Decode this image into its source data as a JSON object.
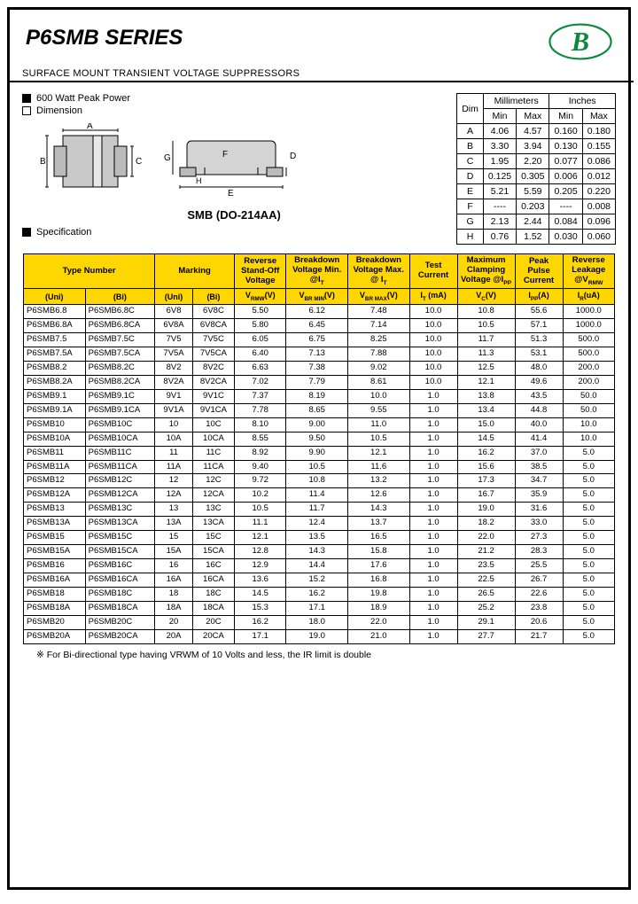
{
  "title": "P6SMB SERIES",
  "subtitle": "SURFACE MOUNT TRANSIENT VOLTAGE SUPPRESSORS",
  "bullets": {
    "peak_power": "600 Watt Peak Power",
    "dimension": "Dimension",
    "specification": "Specification"
  },
  "package_label": "SMB (DO-214AA)",
  "dim_headers": {
    "dim": "Dim",
    "mm": "Millimeters",
    "in": "Inches",
    "min": "Min",
    "max": "Max"
  },
  "dim_rows": [
    {
      "d": "A",
      "mm_min": "4.06",
      "mm_max": "4.57",
      "in_min": "0.160",
      "in_max": "0.180"
    },
    {
      "d": "B",
      "mm_min": "3.30",
      "mm_max": "3.94",
      "in_min": "0.130",
      "in_max": "0.155"
    },
    {
      "d": "C",
      "mm_min": "1.95",
      "mm_max": "2.20",
      "in_min": "0.077",
      "in_max": "0.086"
    },
    {
      "d": "D",
      "mm_min": "0.125",
      "mm_max": "0.305",
      "in_min": "0.006",
      "in_max": "0.012"
    },
    {
      "d": "E",
      "mm_min": "5.21",
      "mm_max": "5.59",
      "in_min": "0.205",
      "in_max": "0.220"
    },
    {
      "d": "F",
      "mm_min": "----",
      "mm_max": "0.203",
      "in_min": "----",
      "in_max": "0.008"
    },
    {
      "d": "G",
      "mm_min": "2.13",
      "mm_max": "2.44",
      "in_min": "0.084",
      "in_max": "0.096"
    },
    {
      "d": "H",
      "mm_min": "0.76",
      "mm_max": "1.52",
      "in_min": "0.030",
      "in_max": "0.060"
    }
  ],
  "spec_headers": {
    "type_number": "Type Number",
    "marking": "Marking",
    "vrmw": "Reverse Stand-Off Voltage",
    "vbrmin": "Breakdown Voltage Min. @I",
    "vbrmax": "Breakdown Voltage Max. @ I",
    "it": "Test Current",
    "vc": "Maximum Clamping Voltage @I",
    "ipp": "Peak Pulse Current",
    "ir": "Reverse Leakage @V",
    "uni": "(Uni)",
    "bi": "(Bi)",
    "vrmw_u": "V",
    "vbrmin_u": "V",
    "vbrmax_u": "V",
    "it_u": "I",
    "vc_u": "V",
    "ipp_u": "I",
    "ir_u": "I"
  },
  "spec_rows": [
    {
      "g": 1,
      "uni": "P6SMB6.8",
      "bi": "P6SMB6.8C",
      "muni": "6V8",
      "mbi": "6V8C",
      "vrmw": "5.50",
      "vbmin": "6.12",
      "vbmax": "7.48",
      "it": "10.0",
      "vc": "10.8",
      "ipp": "55.6",
      "ir": "1000.0"
    },
    {
      "g": 1,
      "uni": "P6SMB6.8A",
      "bi": "P6SMB6.8CA",
      "muni": "6V8A",
      "mbi": "6V8CA",
      "vrmw": "5.80",
      "vbmin": "6.45",
      "vbmax": "7.14",
      "it": "10.0",
      "vc": "10.5",
      "ipp": "57.1",
      "ir": "1000.0"
    },
    {
      "g": 1,
      "uni": "P6SMB7.5",
      "bi": "P6SMB7.5C",
      "muni": "7V5",
      "mbi": "7V5C",
      "vrmw": "6.05",
      "vbmin": "6.75",
      "vbmax": "8.25",
      "it": "10.0",
      "vc": "11.7",
      "ipp": "51.3",
      "ir": "500.0"
    },
    {
      "g": 1,
      "uni": "P6SMB7.5A",
      "bi": "P6SMB7.5CA",
      "muni": "7V5A",
      "mbi": "7V5CA",
      "vrmw": "6.40",
      "vbmin": "7.13",
      "vbmax": "7.88",
      "it": "10.0",
      "vc": "11.3",
      "ipp": "53.1",
      "ir": "500.0"
    },
    {
      "g": 2,
      "uni": "P6SMB8.2",
      "bi": "P6SMB8.2C",
      "muni": "8V2",
      "mbi": "8V2C",
      "vrmw": "6.63",
      "vbmin": "7.38",
      "vbmax": "9.02",
      "it": "10.0",
      "vc": "12.5",
      "ipp": "48.0",
      "ir": "200.0"
    },
    {
      "g": 2,
      "uni": "P6SMB8.2A",
      "bi": "P6SMB8.2CA",
      "muni": "8V2A",
      "mbi": "8V2CA",
      "vrmw": "7.02",
      "vbmin": "7.79",
      "vbmax": "8.61",
      "it": "10.0",
      "vc": "12.1",
      "ipp": "49.6",
      "ir": "200.0"
    },
    {
      "g": 2,
      "uni": "P6SMB9.1",
      "bi": "P6SMB9.1C",
      "muni": "9V1",
      "mbi": "9V1C",
      "vrmw": "7.37",
      "vbmin": "8.19",
      "vbmax": "10.0",
      "it": "1.0",
      "vc": "13.8",
      "ipp": "43.5",
      "ir": "50.0"
    },
    {
      "g": 2,
      "uni": "P6SMB9.1A",
      "bi": "P6SMB9.1CA",
      "muni": "9V1A",
      "mbi": "9V1CA",
      "vrmw": "7.78",
      "vbmin": "8.65",
      "vbmax": "9.55",
      "it": "1.0",
      "vc": "13.4",
      "ipp": "44.8",
      "ir": "50.0"
    },
    {
      "g": 3,
      "uni": "P6SMB10",
      "bi": "P6SMB10C",
      "muni": "10",
      "mbi": "10C",
      "vrmw": "8.10",
      "vbmin": "9.00",
      "vbmax": "11.0",
      "it": "1.0",
      "vc": "15.0",
      "ipp": "40.0",
      "ir": "10.0"
    },
    {
      "g": 3,
      "uni": "P6SMB10A",
      "bi": "P6SMB10CA",
      "muni": "10A",
      "mbi": "10CA",
      "vrmw": "8.55",
      "vbmin": "9.50",
      "vbmax": "10.5",
      "it": "1.0",
      "vc": "14.5",
      "ipp": "41.4",
      "ir": "10.0"
    },
    {
      "g": 3,
      "uni": "P6SMB11",
      "bi": "P6SMB11C",
      "muni": "11",
      "mbi": "11C",
      "vrmw": "8.92",
      "vbmin": "9.90",
      "vbmax": "12.1",
      "it": "1.0",
      "vc": "16.2",
      "ipp": "37.0",
      "ir": "5.0"
    },
    {
      "g": 3,
      "uni": "P6SMB11A",
      "bi": "P6SMB11CA",
      "muni": "11A",
      "mbi": "11CA",
      "vrmw": "9.40",
      "vbmin": "10.5",
      "vbmax": "11.6",
      "it": "1.0",
      "vc": "15.6",
      "ipp": "38.5",
      "ir": "5.0"
    },
    {
      "g": 4,
      "uni": "P6SMB12",
      "bi": "P6SMB12C",
      "muni": "12",
      "mbi": "12C",
      "vrmw": "9.72",
      "vbmin": "10.8",
      "vbmax": "13.2",
      "it": "1.0",
      "vc": "17.3",
      "ipp": "34.7",
      "ir": "5.0"
    },
    {
      "g": 4,
      "uni": "P6SMB12A",
      "bi": "P6SMB12CA",
      "muni": "12A",
      "mbi": "12CA",
      "vrmw": "10.2",
      "vbmin": "11.4",
      "vbmax": "12.6",
      "it": "1.0",
      "vc": "16.7",
      "ipp": "35.9",
      "ir": "5.0"
    },
    {
      "g": 4,
      "uni": "P6SMB13",
      "bi": "P6SMB13C",
      "muni": "13",
      "mbi": "13C",
      "vrmw": "10.5",
      "vbmin": "11.7",
      "vbmax": "14.3",
      "it": "1.0",
      "vc": "19.0",
      "ipp": "31.6",
      "ir": "5.0"
    },
    {
      "g": 4,
      "uni": "P6SMB13A",
      "bi": "P6SMB13CA",
      "muni": "13A",
      "mbi": "13CA",
      "vrmw": "11.1",
      "vbmin": "12.4",
      "vbmax": "13.7",
      "it": "1.0",
      "vc": "18.2",
      "ipp": "33.0",
      "ir": "5.0"
    },
    {
      "g": 5,
      "uni": "P6SMB15",
      "bi": "P6SMB15C",
      "muni": "15",
      "mbi": "15C",
      "vrmw": "12.1",
      "vbmin": "13.5",
      "vbmax": "16.5",
      "it": "1.0",
      "vc": "22.0",
      "ipp": "27.3",
      "ir": "5.0"
    },
    {
      "g": 5,
      "uni": "P6SMB15A",
      "bi": "P6SMB15CA",
      "muni": "15A",
      "mbi": "15CA",
      "vrmw": "12.8",
      "vbmin": "14.3",
      "vbmax": "15.8",
      "it": "1.0",
      "vc": "21.2",
      "ipp": "28.3",
      "ir": "5.0"
    },
    {
      "g": 5,
      "uni": "P6SMB16",
      "bi": "P6SMB16C",
      "muni": "16",
      "mbi": "16C",
      "vrmw": "12.9",
      "vbmin": "14.4",
      "vbmax": "17.6",
      "it": "1.0",
      "vc": "23.5",
      "ipp": "25.5",
      "ir": "5.0"
    },
    {
      "g": 5,
      "uni": "P6SMB16A",
      "bi": "P6SMB16CA",
      "muni": "16A",
      "mbi": "16CA",
      "vrmw": "13.6",
      "vbmin": "15.2",
      "vbmax": "16.8",
      "it": "1.0",
      "vc": "22.5",
      "ipp": "26.7",
      "ir": "5.0"
    },
    {
      "g": 5,
      "uni": "P6SMB18",
      "bi": "P6SMB18C",
      "muni": "18",
      "mbi": "18C",
      "vrmw": "14.5",
      "vbmin": "16.2",
      "vbmax": "19.8",
      "it": "1.0",
      "vc": "26.5",
      "ipp": "22.6",
      "ir": "5.0"
    },
    {
      "g": 5,
      "uni": "P6SMB18A",
      "bi": "P6SMB18CA",
      "muni": "18A",
      "mbi": "18CA",
      "vrmw": "15.3",
      "vbmin": "17.1",
      "vbmax": "18.9",
      "it": "1.0",
      "vc": "25.2",
      "ipp": "23.8",
      "ir": "5.0"
    },
    {
      "g": 5,
      "uni": "P6SMB20",
      "bi": "P6SMB20C",
      "muni": "20",
      "mbi": "20C",
      "vrmw": "16.2",
      "vbmin": "18.0",
      "vbmax": "22.0",
      "it": "1.0",
      "vc": "29.1",
      "ipp": "20.6",
      "ir": "5.0"
    },
    {
      "g": 5,
      "uni": "P6SMB20A",
      "bi": "P6SMB20CA",
      "muni": "20A",
      "mbi": "20CA",
      "vrmw": "17.1",
      "vbmin": "19.0",
      "vbmax": "21.0",
      "it": "1.0",
      "vc": "27.7",
      "ipp": "21.7",
      "ir": "5.0"
    }
  ],
  "footnote": "※  For Bi-directional type having VRWM of 10 Volts and less, the IR limit is double",
  "diagram_labels": {
    "A": "A",
    "B": "B",
    "C": "C",
    "D": "D",
    "E": "E",
    "F": "F",
    "G": "G",
    "H": "H"
  }
}
